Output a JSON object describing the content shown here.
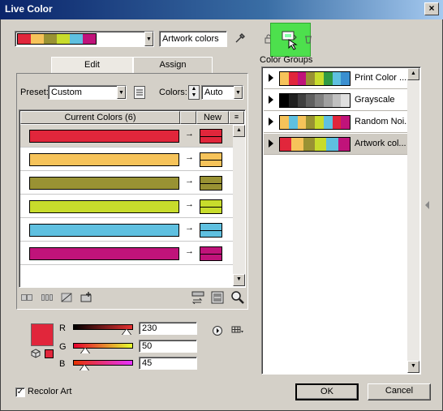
{
  "window": {
    "title": "Live Color",
    "close_label": "×"
  },
  "colors": {
    "red": "#e1263b",
    "orange": "#f6c35a",
    "olive": "#999233",
    "lime": "#c8dc2c",
    "cyan": "#5fc0e0",
    "magenta": "#c0137a"
  },
  "artwork_swatches": [
    "#e1263b",
    "#f6c35a",
    "#999233",
    "#c8dc2c",
    "#5fc0e0",
    "#c0137a"
  ],
  "top": {
    "group_name_value": "Artwork colors",
    "color_groups_label": "Color Groups"
  },
  "tabs": [
    {
      "label": "Edit"
    },
    {
      "label": "Assign"
    }
  ],
  "controls": {
    "preset_label": "Preset:",
    "preset_value": "Custom",
    "colors_label": "Colors:",
    "colors_value": "Auto"
  },
  "table": {
    "current_header": "Current Colors (6)",
    "new_header": "New",
    "rows": [
      {
        "current": "#e1263b",
        "new": "#e1263b"
      },
      {
        "current": "#f6c35a",
        "new": "#f6c35a"
      },
      {
        "current": "#999233",
        "new": "#999233"
      },
      {
        "current": "#c8dc2c",
        "new": "#c8dc2c"
      },
      {
        "current": "#5fc0e0",
        "new": "#5fc0e0"
      },
      {
        "current": "#c0137a",
        "new": "#c0137a"
      }
    ]
  },
  "color_groups": [
    {
      "name": "Print Color ...",
      "swatches": [
        "#f6c35a",
        "#e1263b",
        "#c0137a",
        "#999233",
        "#c8dc2c",
        "#2f9a44",
        "#5fc0e0",
        "#3a8fd0"
      ]
    },
    {
      "name": "Grayscale",
      "swatches": [
        "#000000",
        "#202020",
        "#404040",
        "#606060",
        "#808080",
        "#a0a0a0",
        "#c0c0c0",
        "#e0e0e0"
      ]
    },
    {
      "name": "Random Noi...",
      "swatches": [
        "#f6c35a",
        "#5fc0e0",
        "#f6c35a",
        "#999233",
        "#c8dc2c",
        "#5fc0e0",
        "#e1263b",
        "#c0137a"
      ]
    },
    {
      "name": "Artwork col...",
      "swatches": [
        "#e1263b",
        "#f6c35a",
        "#999233",
        "#c8dc2c",
        "#5fc0e0",
        "#c0137a"
      ]
    }
  ],
  "sliders": {
    "r": {
      "label": "R",
      "value": "230"
    },
    "g": {
      "label": "G",
      "value": "50"
    },
    "b": {
      "label": "B",
      "value": "45"
    }
  },
  "footer": {
    "recolor_label": "Recolor Art",
    "recolor_checked": "✓",
    "ok_label": "OK",
    "cancel_label": "Cancel"
  }
}
